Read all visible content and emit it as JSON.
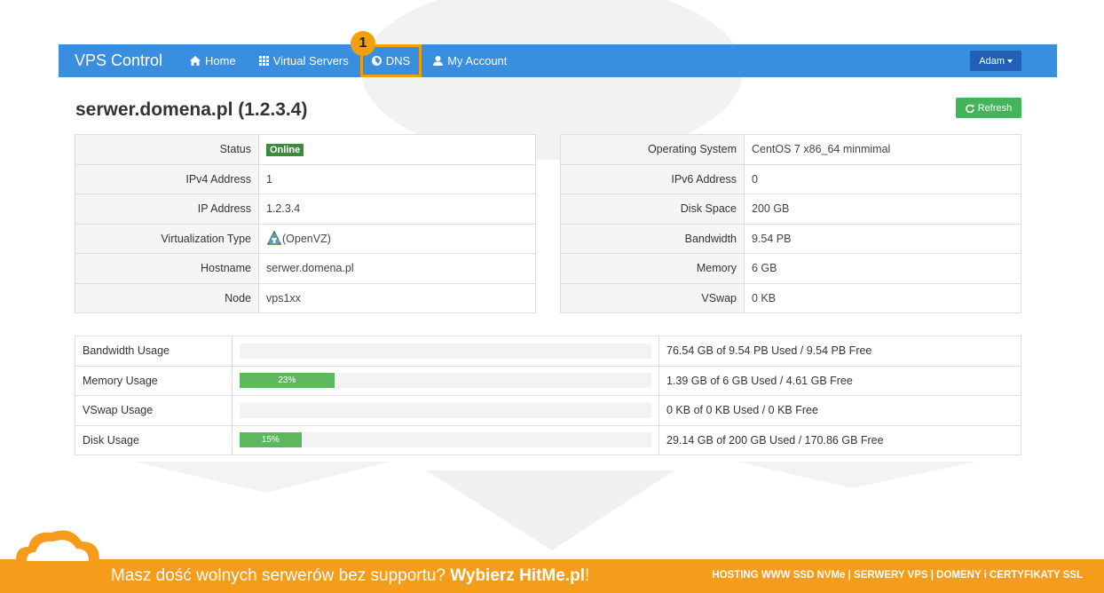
{
  "navbar": {
    "brand": "VPS Control",
    "items": [
      {
        "label": "Home",
        "icon": "home-icon"
      },
      {
        "label": "Virtual Servers",
        "icon": "grid-icon"
      },
      {
        "label": "DNS",
        "icon": "globe-icon"
      },
      {
        "label": "My Account",
        "icon": "user-icon"
      }
    ],
    "user": "Adam"
  },
  "step_badge": "1",
  "page": {
    "title": "serwer.domena.pl (1.2.3.4)",
    "refresh_label": "Refresh"
  },
  "info_left": [
    {
      "label": "Status",
      "value": "Online"
    },
    {
      "label": "IPv4 Address",
      "value": "1"
    },
    {
      "label": "IP Address",
      "value": "1.2.3.4"
    },
    {
      "label": "Virtualization Type",
      "value": "(OpenVZ)"
    },
    {
      "label": "Hostname",
      "value": "serwer.domena.pl"
    },
    {
      "label": "Node",
      "value": "vps1xx"
    }
  ],
  "info_right": [
    {
      "label": "Operating System",
      "value": "CentOS 7 x86_64 minmimal"
    },
    {
      "label": "IPv6 Address",
      "value": "0"
    },
    {
      "label": "Disk Space",
      "value": "200 GB"
    },
    {
      "label": "Bandwidth",
      "value": "9.54 PB"
    },
    {
      "label": "Memory",
      "value": "6 GB"
    },
    {
      "label": "VSwap",
      "value": "0 KB"
    }
  ],
  "usage": [
    {
      "label": "Bandwidth Usage",
      "percent": 0,
      "percent_text": "",
      "detail": "76.54 GB of 9.54 PB Used / 9.54 PB Free"
    },
    {
      "label": "Memory Usage",
      "percent": 23,
      "percent_text": "23%",
      "detail": "1.39 GB of 6 GB Used / 4.61 GB Free"
    },
    {
      "label": "VSwap Usage",
      "percent": 0,
      "percent_text": "",
      "detail": "0 KB of 0 KB Used / 0 KB Free"
    },
    {
      "label": "Disk Usage",
      "percent": 15,
      "percent_text": "15%",
      "detail": "29.14 GB of 200 GB Used / 170.86 GB Free"
    }
  ],
  "footer": {
    "slogan_text": "Masz dość wolnych serwerów bez supportu? ",
    "slogan_bold": "Wybierz HitMe.pl",
    "slogan_end": "!",
    "links": "HOSTING WWW SSD NVMe | SERWERY VPS | DOMENY i CERTYFIKATY SSL"
  },
  "colors": {
    "navbar": "#3a8ee0",
    "highlight": "#f2a007",
    "online": "#3c8a3e",
    "bar": "#5cb85c",
    "refresh": "#45b35a",
    "footer": "#f59c1a"
  }
}
